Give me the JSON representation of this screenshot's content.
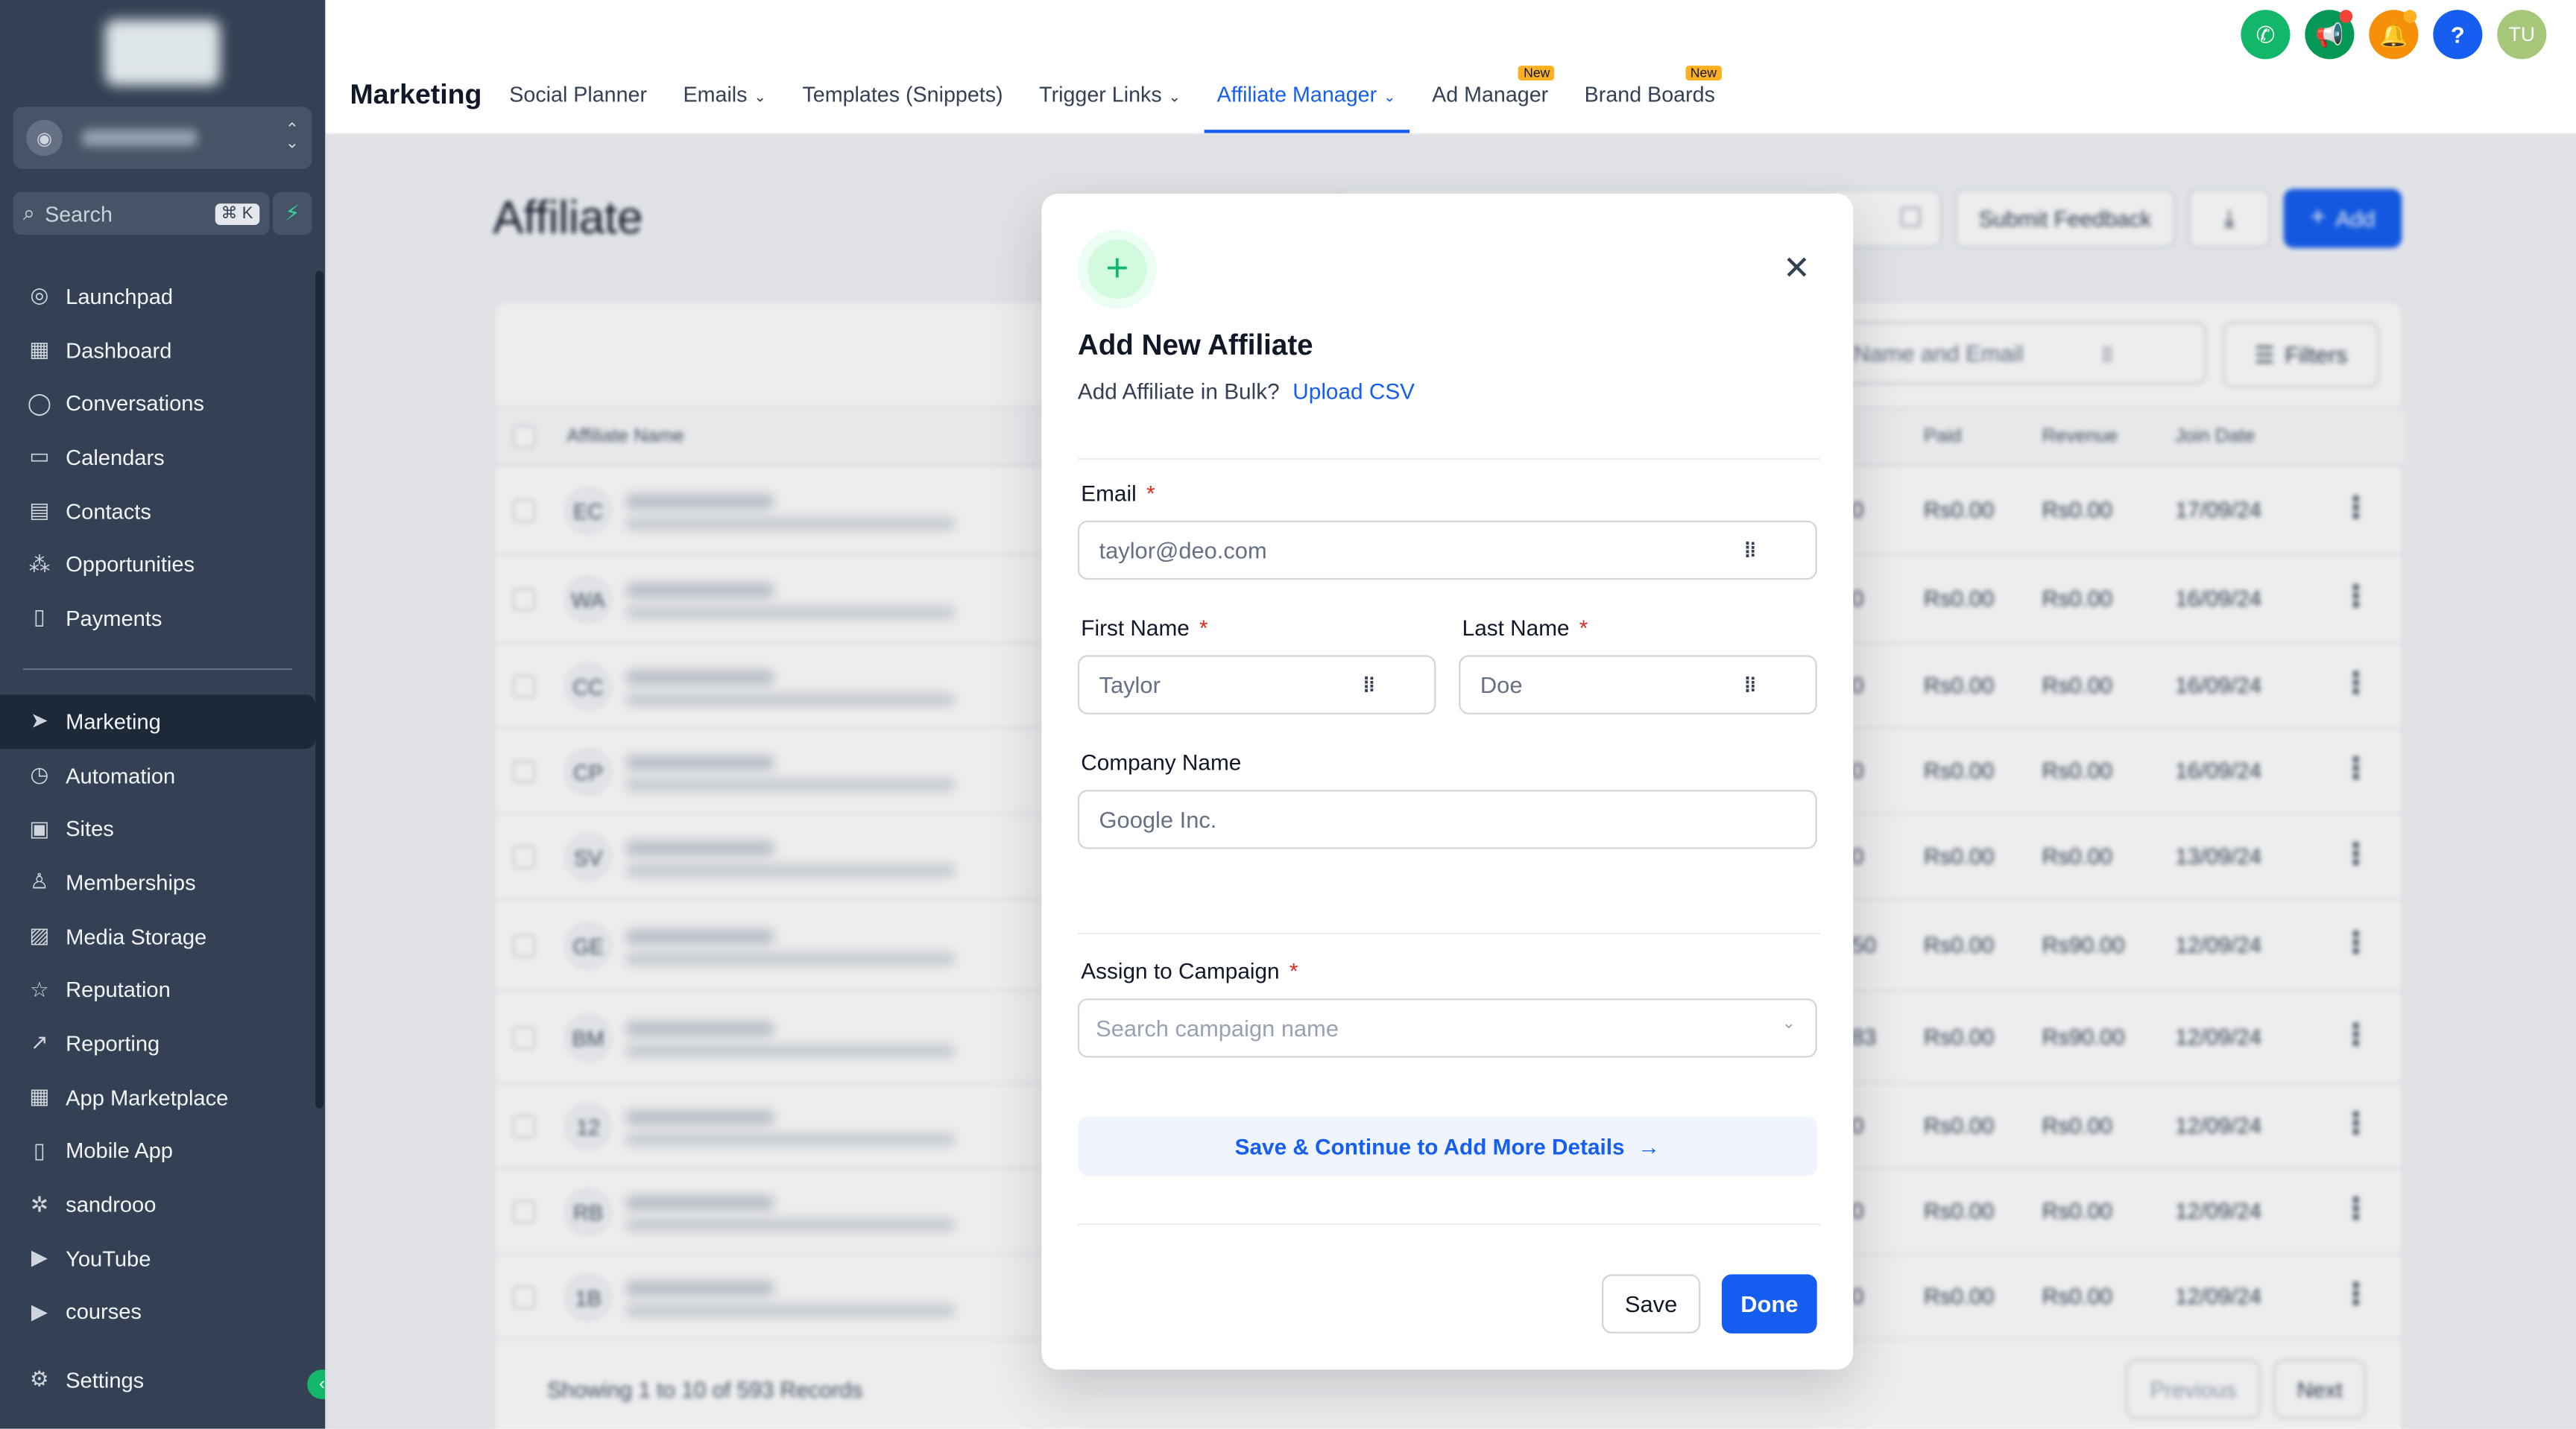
{
  "sidebar": {
    "search_placeholder": "Search",
    "search_shortcut": "⌘ K",
    "items": [
      {
        "label": "Launchpad",
        "icon": "launchpad-icon",
        "glyph": "◎"
      },
      {
        "label": "Dashboard",
        "icon": "dashboard-icon",
        "glyph": "▦"
      },
      {
        "label": "Conversations",
        "icon": "chat-icon",
        "glyph": "◯"
      },
      {
        "label": "Calendars",
        "icon": "calendar-icon",
        "glyph": "▭"
      },
      {
        "label": "Contacts",
        "icon": "contacts-icon",
        "glyph": "▤"
      },
      {
        "label": "Opportunities",
        "icon": "opportunities-icon",
        "glyph": "⁂"
      },
      {
        "label": "Payments",
        "icon": "payments-icon",
        "glyph": "▯"
      }
    ],
    "items2": [
      {
        "label": "Marketing",
        "icon": "send-icon",
        "glyph": "➤",
        "active": true
      },
      {
        "label": "Automation",
        "icon": "automation-icon",
        "glyph": "◷"
      },
      {
        "label": "Sites",
        "icon": "sites-icon",
        "glyph": "▣"
      },
      {
        "label": "Memberships",
        "icon": "memberships-icon",
        "glyph": "♙"
      },
      {
        "label": "Media Storage",
        "icon": "media-icon",
        "glyph": "▨"
      },
      {
        "label": "Reputation",
        "icon": "star-icon",
        "glyph": "☆"
      },
      {
        "label": "Reporting",
        "icon": "reporting-icon",
        "glyph": "↗"
      },
      {
        "label": "App Marketplace",
        "icon": "marketplace-icon",
        "glyph": "▦"
      },
      {
        "label": "Mobile App",
        "icon": "mobile-icon",
        "glyph": "▯"
      },
      {
        "label": "sandrooo",
        "icon": "custom-icon",
        "glyph": "✲"
      },
      {
        "label": "YouTube",
        "icon": "youtube-icon",
        "glyph": "▶"
      },
      {
        "label": "courses",
        "icon": "courses-icon",
        "glyph": "▶"
      }
    ],
    "settings_label": "Settings"
  },
  "topbar": {
    "title": "Marketing",
    "tabs": [
      {
        "label": "Social Planner",
        "dropdown": false,
        "new": false
      },
      {
        "label": "Emails",
        "dropdown": true,
        "new": false
      },
      {
        "label": "Templates (Snippets)",
        "dropdown": false,
        "new": false
      },
      {
        "label": "Trigger Links",
        "dropdown": true,
        "new": false
      },
      {
        "label": "Affiliate Manager",
        "dropdown": true,
        "new": false,
        "active": true
      },
      {
        "label": "Ad Manager",
        "dropdown": false,
        "new": true
      },
      {
        "label": "Brand Boards",
        "dropdown": false,
        "new": true
      }
    ],
    "new_badge": "New",
    "avatar_initials": "TU",
    "colors": {
      "phone": "#12b76a",
      "megaphone": "#039855",
      "bell": "#f79009",
      "help": "#155eef",
      "avatar": "#a6c77a"
    }
  },
  "main": {
    "page_title": "Affiliate",
    "submit_feedback": "Submit Feedback",
    "add_label": "Add",
    "search_placeholder": "Name and Email",
    "filters_label": "Filters",
    "columns": {
      "name": "Affiliate Name",
      "paid": "Paid",
      "revenue": "Revenue",
      "join_date": "Join Date"
    },
    "rows": [
      {
        "initials": "EC",
        "partial": "0",
        "paid": "Rs0.00",
        "revenue": "Rs0.00",
        "join": "17/09/24"
      },
      {
        "initials": "WA",
        "partial": "0",
        "paid": "Rs0.00",
        "revenue": "Rs0.00",
        "join": "16/09/24"
      },
      {
        "initials": "CC",
        "partial": "0",
        "paid": "Rs0.00",
        "revenue": "Rs0.00",
        "join": "16/09/24"
      },
      {
        "initials": "CP",
        "partial": "0",
        "paid": "Rs0.00",
        "revenue": "Rs0.00",
        "join": "16/09/24"
      },
      {
        "initials": "SV",
        "partial": "0",
        "paid": "Rs0.00",
        "revenue": "Rs0.00",
        "join": "13/09/24"
      },
      {
        "initials": "GE",
        "partial": "50",
        "paid": "Rs0.00",
        "revenue": "Rs90.00",
        "join": "12/09/24"
      },
      {
        "initials": "BM",
        "partial": "83",
        "paid": "Rs0.00",
        "revenue": "Rs90.00",
        "join": "12/09/24"
      },
      {
        "initials": "12",
        "partial": "0",
        "paid": "Rs0.00",
        "revenue": "Rs0.00",
        "join": "12/09/24"
      },
      {
        "initials": "RB",
        "partial": "0",
        "paid": "Rs0.00",
        "revenue": "Rs0.00",
        "join": "12/09/24"
      },
      {
        "initials": "1B",
        "partial": "0",
        "paid": "Rs0.00",
        "revenue": "Rs0.00",
        "join": "12/09/24"
      }
    ],
    "footer_text": "Showing 1 to 10 of 593 Records",
    "previous": "Previous",
    "next": "Next"
  },
  "modal": {
    "title": "Add New Affiliate",
    "bulk_text": "Add Affiliate in Bulk?",
    "upload_csv": "Upload CSV",
    "email_label": "Email",
    "email_placeholder": "taylor@deo.com",
    "first_name_label": "First Name",
    "first_name_placeholder": "Taylor",
    "last_name_label": "Last Name",
    "last_name_placeholder": "Doe",
    "company_label": "Company Name",
    "company_placeholder": "Google Inc.",
    "campaign_label": "Assign to Campaign",
    "campaign_placeholder": "Search campaign name",
    "continue_label": "Save & Continue to Add More Details",
    "save_label": "Save",
    "done_label": "Done",
    "required_mark": "*"
  }
}
